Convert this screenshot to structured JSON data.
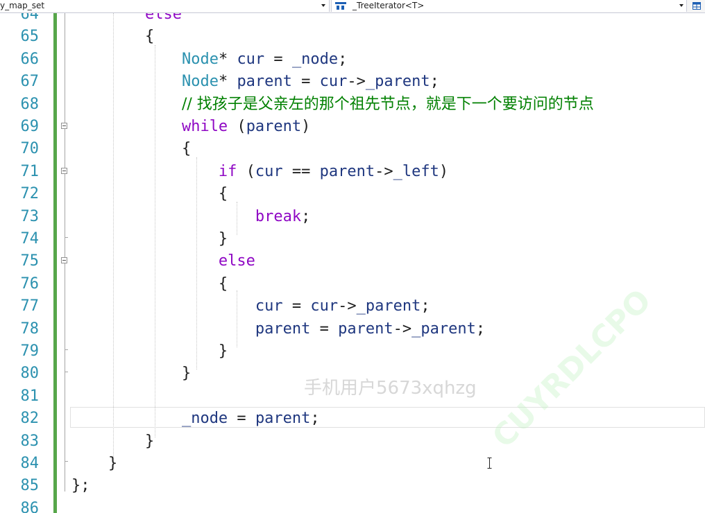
{
  "navbar": {
    "project_scope": "y_map_set",
    "type_scope": "_TreeIterator<T>"
  },
  "editor": {
    "lines": [
      {
        "num": "64",
        "tokens": [
          {
            "t": "        ",
            "c": "op"
          },
          {
            "t": "else",
            "c": "kw"
          }
        ]
      },
      {
        "num": "65",
        "tokens": [
          {
            "t": "        {",
            "c": "op"
          }
        ]
      },
      {
        "num": "66",
        "tokens": [
          {
            "t": "            ",
            "c": "op"
          },
          {
            "t": "Node",
            "c": "type"
          },
          {
            "t": "* ",
            "c": "op"
          },
          {
            "t": "cur",
            "c": "var"
          },
          {
            "t": " = ",
            "c": "op"
          },
          {
            "t": "_node",
            "c": "var"
          },
          {
            "t": ";",
            "c": "op"
          }
        ]
      },
      {
        "num": "67",
        "tokens": [
          {
            "t": "            ",
            "c": "op"
          },
          {
            "t": "Node",
            "c": "type"
          },
          {
            "t": "* ",
            "c": "op"
          },
          {
            "t": "parent",
            "c": "var"
          },
          {
            "t": " = ",
            "c": "op"
          },
          {
            "t": "cur",
            "c": "var"
          },
          {
            "t": "->",
            "c": "op"
          },
          {
            "t": "_parent",
            "c": "var"
          },
          {
            "t": ";",
            "c": "op"
          }
        ]
      },
      {
        "num": "68",
        "tokens": [
          {
            "t": "            ",
            "c": "op"
          },
          {
            "t": "// 找孩子是父亲左的那个祖先节点，就是下一个要访问的节点",
            "c": "cmt"
          }
        ]
      },
      {
        "num": "69",
        "tokens": [
          {
            "t": "            ",
            "c": "op"
          },
          {
            "t": "while",
            "c": "kw"
          },
          {
            "t": " (",
            "c": "op"
          },
          {
            "t": "parent",
            "c": "var"
          },
          {
            "t": ")",
            "c": "op"
          }
        ]
      },
      {
        "num": "70",
        "tokens": [
          {
            "t": "            {",
            "c": "op"
          }
        ]
      },
      {
        "num": "71",
        "tokens": [
          {
            "t": "                ",
            "c": "op"
          },
          {
            "t": "if",
            "c": "kw"
          },
          {
            "t": " (",
            "c": "op"
          },
          {
            "t": "cur",
            "c": "var"
          },
          {
            "t": " == ",
            "c": "op"
          },
          {
            "t": "parent",
            "c": "var"
          },
          {
            "t": "->",
            "c": "op"
          },
          {
            "t": "_left",
            "c": "var"
          },
          {
            "t": ")",
            "c": "op"
          }
        ]
      },
      {
        "num": "72",
        "tokens": [
          {
            "t": "                {",
            "c": "op"
          }
        ]
      },
      {
        "num": "73",
        "tokens": [
          {
            "t": "                    ",
            "c": "op"
          },
          {
            "t": "break",
            "c": "kw"
          },
          {
            "t": ";",
            "c": "op"
          }
        ]
      },
      {
        "num": "74",
        "tokens": [
          {
            "t": "                }",
            "c": "op"
          }
        ]
      },
      {
        "num": "75",
        "tokens": [
          {
            "t": "                ",
            "c": "op"
          },
          {
            "t": "else",
            "c": "kw"
          }
        ]
      },
      {
        "num": "76",
        "tokens": [
          {
            "t": "                {",
            "c": "op"
          }
        ]
      },
      {
        "num": "77",
        "tokens": [
          {
            "t": "                    ",
            "c": "op"
          },
          {
            "t": "cur",
            "c": "var"
          },
          {
            "t": " = ",
            "c": "op"
          },
          {
            "t": "cur",
            "c": "var"
          },
          {
            "t": "->",
            "c": "op"
          },
          {
            "t": "_parent",
            "c": "var"
          },
          {
            "t": ";",
            "c": "op"
          }
        ]
      },
      {
        "num": "78",
        "tokens": [
          {
            "t": "                    ",
            "c": "op"
          },
          {
            "t": "parent",
            "c": "var"
          },
          {
            "t": " = ",
            "c": "op"
          },
          {
            "t": "parent",
            "c": "var"
          },
          {
            "t": "->",
            "c": "op"
          },
          {
            "t": "_parent",
            "c": "var"
          },
          {
            "t": ";",
            "c": "op"
          }
        ]
      },
      {
        "num": "79",
        "tokens": [
          {
            "t": "                }",
            "c": "op"
          }
        ]
      },
      {
        "num": "80",
        "tokens": [
          {
            "t": "            }",
            "c": "op"
          }
        ]
      },
      {
        "num": "81",
        "tokens": []
      },
      {
        "num": "82",
        "tokens": [
          {
            "t": "            ",
            "c": "op"
          },
          {
            "t": "_node",
            "c": "var"
          },
          {
            "t": " = ",
            "c": "op"
          },
          {
            "t": "parent",
            "c": "var"
          },
          {
            "t": ";",
            "c": "op"
          }
        ]
      },
      {
        "num": "83",
        "tokens": [
          {
            "t": "        }",
            "c": "op"
          }
        ]
      },
      {
        "num": "84",
        "tokens": [
          {
            "t": "    }",
            "c": "op"
          }
        ]
      },
      {
        "num": "85",
        "tokens": [
          {
            "t": "};",
            "c": "op"
          }
        ]
      },
      {
        "num": "86",
        "tokens": []
      }
    ]
  },
  "overlay": {
    "watermark_user": "手机用户5673xqhzg",
    "watermark_logo": "CUYRDLCPO"
  },
  "colors": {
    "keyword": "#8f08c4",
    "type": "#2b91af",
    "variable": "#1f377f",
    "comment": "#008000",
    "line_number": "#2b91af",
    "change_bar": "#57a64a"
  }
}
